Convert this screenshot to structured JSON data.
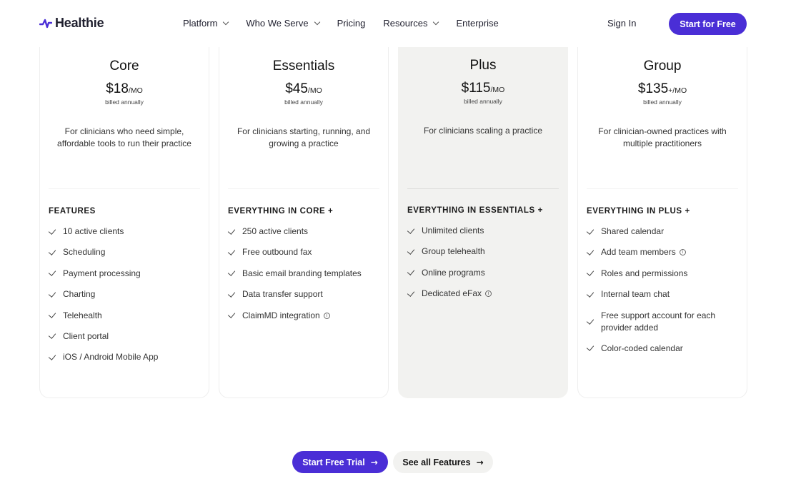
{
  "brand": {
    "name": "Healthie",
    "accent": "#4a2ed6"
  },
  "nav": {
    "items": [
      {
        "label": "Platform",
        "dropdown": true
      },
      {
        "label": "Who We Serve",
        "dropdown": true
      },
      {
        "label": "Pricing",
        "dropdown": false
      },
      {
        "label": "Resources",
        "dropdown": true
      },
      {
        "label": "Enterprise",
        "dropdown": false
      }
    ],
    "sign_in": "Sign In",
    "cta": "Start for Free"
  },
  "plans": [
    {
      "name": "Core",
      "price": "$18",
      "per": "/MO",
      "billed": "billed annually",
      "description": "For clinicians who need simple, affordable tools to run their practice",
      "features_heading": "FEATURES",
      "features": [
        {
          "label": "10 active clients",
          "info": false
        },
        {
          "label": "Scheduling",
          "info": false
        },
        {
          "label": "Payment processing",
          "info": false
        },
        {
          "label": "Charting",
          "info": false
        },
        {
          "label": "Telehealth",
          "info": false
        },
        {
          "label": "Client portal",
          "info": false
        },
        {
          "label": "iOS / Android Mobile App",
          "info": false
        }
      ]
    },
    {
      "name": "Essentials",
      "price": "$45",
      "per": "/MO",
      "billed": "billed annually",
      "description": "For clinicians starting, running, and growing a practice",
      "features_heading": "EVERYTHING IN CORE +",
      "features": [
        {
          "label": "250 active clients",
          "info": false
        },
        {
          "label": "Free outbound fax",
          "info": false
        },
        {
          "label": "Basic email branding templates",
          "info": false
        },
        {
          "label": "Data transfer support",
          "info": false
        },
        {
          "label": "ClaimMD integration",
          "info": true
        }
      ]
    },
    {
      "name": "Plus",
      "price": "$115",
      "per": "/MO",
      "billed": "billed annually",
      "description": "For clinicians scaling a practice",
      "features_heading": "EVERYTHING IN ESSENTIALS +",
      "highlight": true,
      "features": [
        {
          "label": "Unlimited clients",
          "info": false
        },
        {
          "label": "Group telehealth",
          "info": false
        },
        {
          "label": "Online programs",
          "info": false
        },
        {
          "label": "Dedicated eFax",
          "info": true
        }
      ]
    },
    {
      "name": "Group",
      "price": "$135",
      "per": "+/MO",
      "billed": "billed annually",
      "description": "For clinician-owned practices with multiple practitioners",
      "features_heading": "EVERYTHING IN PLUS +",
      "features": [
        {
          "label": "Shared calendar",
          "info": false
        },
        {
          "label": "Add team members",
          "info": true
        },
        {
          "label": "Roles and permissions",
          "info": false
        },
        {
          "label": "Internal team chat",
          "info": false
        },
        {
          "label": "Free support account for each provider added",
          "info": false
        },
        {
          "label": "Color-coded calendar",
          "info": false
        }
      ]
    }
  ],
  "bottom": {
    "trial": "Start Free Trial",
    "features": "See all Features"
  }
}
